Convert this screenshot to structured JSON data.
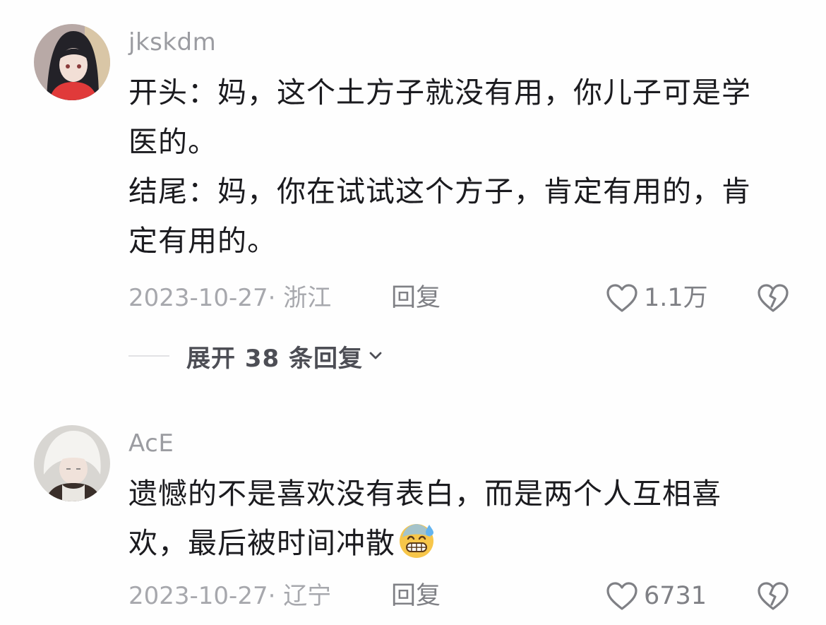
{
  "comments": [
    {
      "username": "jkskdm",
      "lines": [
        "开头：妈，这个土方子就没有用，你儿子可是学",
        "医的。",
        "结尾：妈，你在试试这个方子，肯定有用的，肯",
        "定有用的。"
      ],
      "date_location": "2023-10-27· 浙江",
      "reply_label": "回复",
      "like_count": "1.1万",
      "expand_label": "展开 38 条回复"
    },
    {
      "username": "AcE",
      "lines": [
        "遗憾的不是喜欢没有表白，而是两个人互相喜",
        "欢，最后被时间冲散"
      ],
      "emoji": "grimacing-sweat-emoji",
      "date_location": "2023-10-27· 辽宁",
      "reply_label": "回复",
      "like_count": "6731"
    }
  ],
  "colors": {
    "username": "#9b9ca1",
    "text": "#1b1b1f",
    "meta": "#a7a8ad",
    "action": "#7f8085",
    "background": "#fefefe"
  }
}
